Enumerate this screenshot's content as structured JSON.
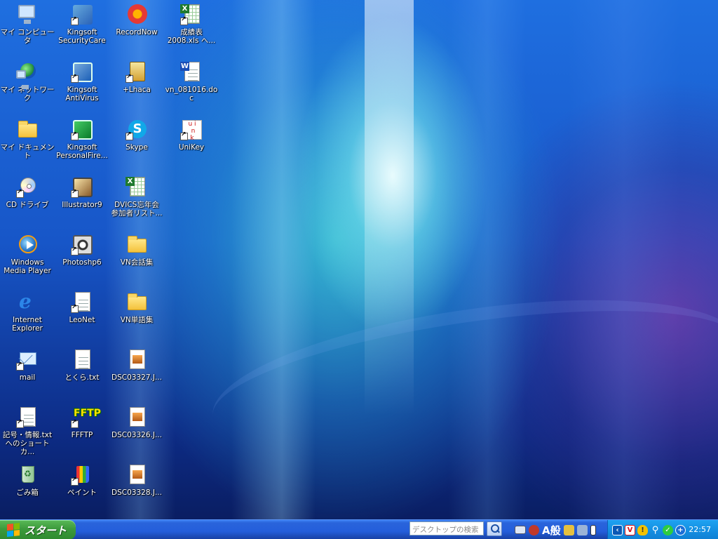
{
  "desktop": {
    "icons": [
      {
        "label": "マイ コンピュータ",
        "label2": "",
        "icon": "my-computer-icon"
      },
      {
        "label": "マイ ネットワーク",
        "label2": "",
        "icon": "network-icon"
      },
      {
        "label": "マイ ドキュメント",
        "label2": "",
        "icon": "my-documents-icon"
      },
      {
        "label": "CD ドライブ",
        "label2": "",
        "icon": "cd-drive-icon"
      },
      {
        "label": "Windows",
        "label2": "Media Player",
        "icon": "media-player-icon"
      },
      {
        "label": "Internet",
        "label2": "Explorer",
        "icon": "internet-explorer-icon"
      },
      {
        "label": "mail",
        "label2": "",
        "icon": "mail-icon"
      },
      {
        "label": "記号・情報.txt",
        "label2": "へのショートカ...",
        "icon": "text-file-icon"
      },
      {
        "label": "ごみ箱",
        "label2": "",
        "icon": "recycle-bin-icon"
      },
      {
        "label": "Kingsoft",
        "label2": "SecurityCare",
        "icon": "kingsoft-securitycare-icon"
      },
      {
        "label": "Kingsoft",
        "label2": "AntiVirus",
        "icon": "kingsoft-antivirus-icon"
      },
      {
        "label": "Kingsoft",
        "label2": "PersonalFire...",
        "icon": "kingsoft-firewall-icon"
      },
      {
        "label": "Illustrator9",
        "label2": "",
        "icon": "illustrator-icon"
      },
      {
        "label": "Photoshp6",
        "label2": "",
        "icon": "photoshop-icon"
      },
      {
        "label": "LeoNet",
        "label2": "",
        "icon": "leonet-icon"
      },
      {
        "label": "とくら.txt",
        "label2": "",
        "icon": "text-file-icon"
      },
      {
        "label": "FFFTP",
        "label2": "",
        "icon": "ffftp-icon"
      },
      {
        "label": "ペイント",
        "label2": "",
        "icon": "paint-icon"
      },
      {
        "label": "RecordNow",
        "label2": "",
        "icon": "recordnow-icon"
      },
      {
        "label": "+Lhaca",
        "label2": "",
        "icon": "lhaca-icon"
      },
      {
        "label": "Skype",
        "label2": "",
        "icon": "skype-icon"
      },
      {
        "label": "DVICS忘年会",
        "label2": "参加者リスト...",
        "icon": "excel-file-icon"
      },
      {
        "label": "VN会話集",
        "label2": "",
        "icon": "folder-icon"
      },
      {
        "label": "VN単語集",
        "label2": "",
        "icon": "folder-icon"
      },
      {
        "label": "DSC03327.J...",
        "label2": "",
        "icon": "image-file-icon"
      },
      {
        "label": "DSC03326.J...",
        "label2": "",
        "icon": "image-file-icon"
      },
      {
        "label": "DSC03328.J...",
        "label2": "",
        "icon": "image-file-icon"
      },
      {
        "label": "成績表",
        "label2": "2008.xls へ...",
        "icon": "excel-file-icon"
      },
      {
        "label": "vn_081016.doc",
        "label2": "",
        "icon": "word-file-icon"
      },
      {
        "label": "UniKey",
        "label2": "",
        "icon": "unikey-icon"
      }
    ]
  },
  "taskbar": {
    "start_label": "スタート",
    "search_placeholder": "デスクトップの検索",
    "ime_label": "A般",
    "clock": "22:57"
  },
  "colors": {
    "taskbar_blue": "#245edb",
    "start_green": "#3c9a3c",
    "tray_blue": "#1590e3"
  }
}
